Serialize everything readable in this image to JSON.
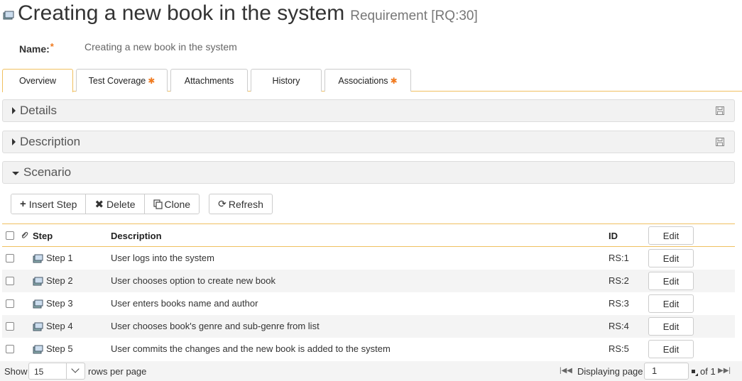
{
  "header": {
    "title": "Creating a new book in the system",
    "subtitle": "Requirement [RQ:30]",
    "icon": "requirement-icon"
  },
  "name_field": {
    "label": "Name:",
    "required_mark": "*",
    "value": "Creating a new book in the system"
  },
  "tabs": [
    {
      "label": "Overview",
      "active": true,
      "flag": ""
    },
    {
      "label": "Test Coverage",
      "active": false,
      "flag": "✱"
    },
    {
      "label": "Attachments",
      "active": false,
      "flag": ""
    },
    {
      "label": "History",
      "active": false,
      "flag": ""
    },
    {
      "label": "Associations",
      "active": false,
      "flag": "✱"
    }
  ],
  "panels": {
    "details": {
      "title": "Details",
      "expanded": false
    },
    "description": {
      "title": "Description",
      "expanded": false
    },
    "scenario": {
      "title": "Scenario",
      "expanded": true
    }
  },
  "toolbar": {
    "insert_step": "Insert Step",
    "delete": "Delete",
    "clone": "Clone",
    "refresh": "Refresh"
  },
  "grid": {
    "columns": {
      "step": "Step",
      "description": "Description",
      "id": "ID",
      "edit": "Edit"
    },
    "rows": [
      {
        "step": "Step 1",
        "description": "User logs into the system",
        "id": "RS:1",
        "edit": "Edit"
      },
      {
        "step": "Step 2",
        "description": "User chooses option to create new book",
        "id": "RS:2",
        "edit": "Edit"
      },
      {
        "step": "Step 3",
        "description": "User enters books name and author",
        "id": "RS:3",
        "edit": "Edit"
      },
      {
        "step": "Step 4",
        "description": "User chooses book's genre and sub-genre from list",
        "id": "RS:4",
        "edit": "Edit"
      },
      {
        "step": "Step 5",
        "description": "User commits the changes and the new book is added to the system",
        "id": "RS:5",
        "edit": "Edit"
      }
    ]
  },
  "footer": {
    "show_label": "Show",
    "rows_value": "15",
    "rows_per_page_label": "rows per page",
    "displaying_label": "Displaying page",
    "page_value": "1",
    "of_label": "of 1"
  },
  "colors": {
    "accent": "#f0c060",
    "required": "#f07a1f",
    "panel_bg": "#f2f2f2"
  }
}
